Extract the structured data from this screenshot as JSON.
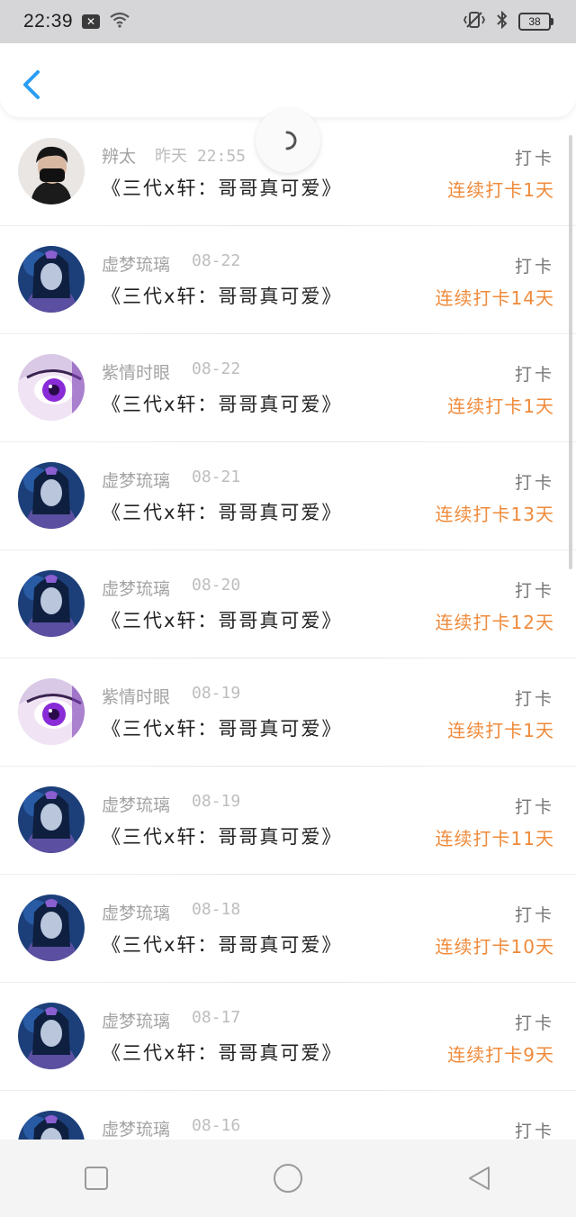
{
  "status_bar": {
    "time": "22:39",
    "notification_icon": "x-notification-icon",
    "wifi_icon": "wifi-icon",
    "vibrate_icon": "vibrate-icon",
    "bluetooth_icon": "bluetooth-icon",
    "battery_level": "38"
  },
  "header": {
    "back_icon": "chevron-left-icon",
    "accent_color": "#2a9df4"
  },
  "streak_color": "#ef8a3a",
  "checkins": [
    {
      "name": "辨太",
      "date": "昨天 22:55",
      "title": "《三代x轩：哥哥真可爱》",
      "action": "打卡",
      "streak": "连续打卡1天",
      "avatar": "masked-man"
    },
    {
      "name": "虚梦琉璃",
      "date": "08-22",
      "title": "《三代x轩：哥哥真可爱》",
      "action": "打卡",
      "streak": "连续打卡14天",
      "avatar": "doll"
    },
    {
      "name": "紫情时眼",
      "date": "08-22",
      "title": "《三代x轩：哥哥真可爱》",
      "action": "打卡",
      "streak": "连续打卡1天",
      "avatar": "purple-eye"
    },
    {
      "name": "虚梦琉璃",
      "date": "08-21",
      "title": "《三代x轩：哥哥真可爱》",
      "action": "打卡",
      "streak": "连续打卡13天",
      "avatar": "doll"
    },
    {
      "name": "虚梦琉璃",
      "date": "08-20",
      "title": "《三代x轩：哥哥真可爱》",
      "action": "打卡",
      "streak": "连续打卡12天",
      "avatar": "doll"
    },
    {
      "name": "紫情时眼",
      "date": "08-19",
      "title": "《三代x轩：哥哥真可爱》",
      "action": "打卡",
      "streak": "连续打卡1天",
      "avatar": "purple-eye"
    },
    {
      "name": "虚梦琉璃",
      "date": "08-19",
      "title": "《三代x轩：哥哥真可爱》",
      "action": "打卡",
      "streak": "连续打卡11天",
      "avatar": "doll"
    },
    {
      "name": "虚梦琉璃",
      "date": "08-18",
      "title": "《三代x轩：哥哥真可爱》",
      "action": "打卡",
      "streak": "连续打卡10天",
      "avatar": "doll"
    },
    {
      "name": "虚梦琉璃",
      "date": "08-17",
      "title": "《三代x轩：哥哥真可爱》",
      "action": "打卡",
      "streak": "连续打卡9天",
      "avatar": "doll"
    },
    {
      "name": "虚梦琉璃",
      "date": "08-16",
      "title": "",
      "action": "打卡",
      "streak": "",
      "avatar": "doll"
    }
  ],
  "nav_bar": {
    "recent_icon": "square-recent-apps-icon",
    "home_icon": "circle-home-icon",
    "back_icon": "triangle-back-icon"
  }
}
